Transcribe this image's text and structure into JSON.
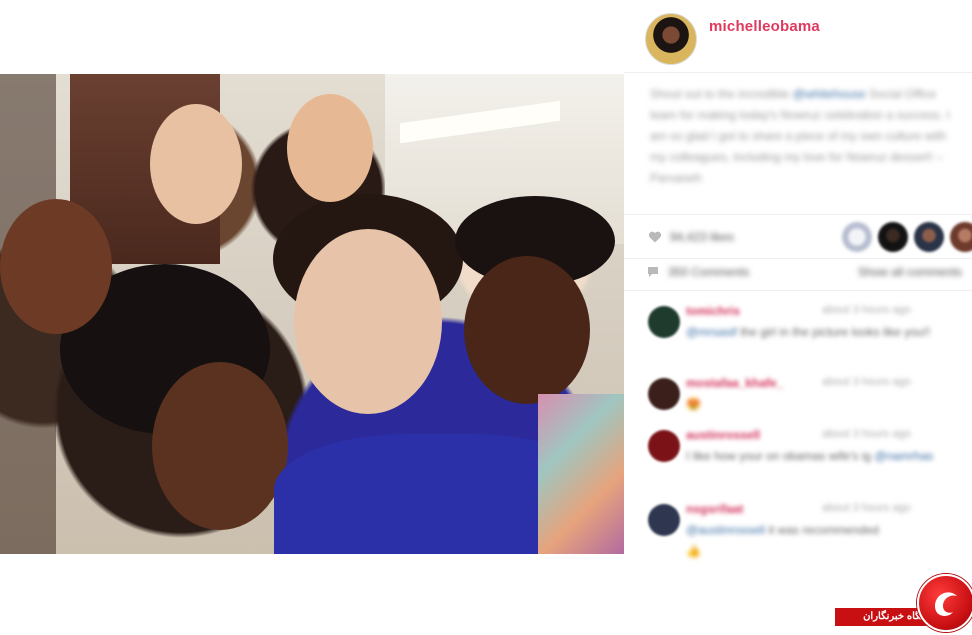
{
  "post": {
    "username": "michelleobama",
    "caption": {
      "text_before_mention": "Shout out to the incredible ",
      "mention": "@whitehouse",
      "text_after_mention": " Social Office team for making today's Nowruz celebration a success. I am so glad I got to share a piece of my own culture with my colleagues, including my love for Nowruz dessert! – Parvaneh"
    },
    "likes": "94,423 likes",
    "comments_count": "350 Comments",
    "show_all_label": "Show all comments"
  },
  "comments": [
    {
      "user": "tomichris",
      "time": "about 3 hours ago",
      "mention": "@mrsasif",
      "text": " the girl in the picture looks like you!!",
      "avatar_color": "#1f3b2e"
    },
    {
      "user": "mostafaa_khafe_",
      "time": "about 3 hours ago",
      "mention": "",
      "text": "😍",
      "avatar_color": "#3a1f1a"
    },
    {
      "user": "austinrossell",
      "time": "about 3 hours ago",
      "mention": "",
      "text": "I like how your on obamas wife's ig ",
      "text_mention": "@namrhas",
      "avatar_color": "#7b1218"
    },
    {
      "user": "nsgsrifaat",
      "time": "about 3 hours ago",
      "mention": "@austinrossell",
      "text": " it was recommended",
      "extra": "👍",
      "avatar_color": "#2e3650"
    }
  ],
  "watermark": {
    "label": "باشگاه خبرنگاران"
  },
  "colors": {
    "username": "#e0395e",
    "comment_user": "#d2315a",
    "link": "#3b6ea5",
    "watermark_red": "#c81013"
  }
}
